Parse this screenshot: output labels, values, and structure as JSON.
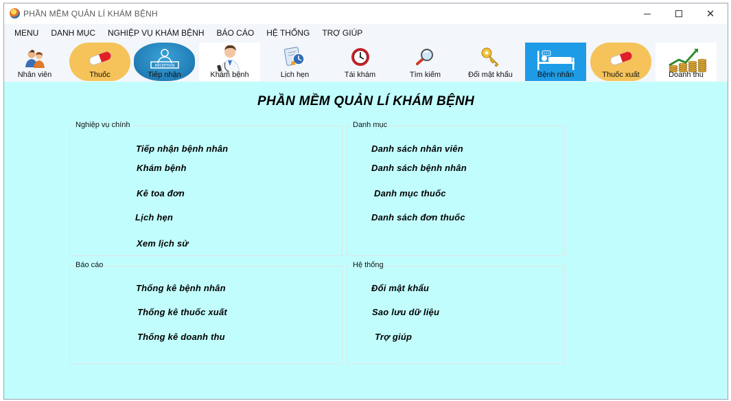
{
  "window": {
    "title": "PHẦN MỀM QUẢN LÍ KHÁM BỆNH"
  },
  "menu": [
    "MENU",
    "DANH MỤC",
    "NGHIỆP VỤ KHÁM BỆNH",
    "BÁO CÁO",
    "HỆ THỐNG",
    "TRỢ GIÚP"
  ],
  "toolbar": [
    {
      "label": "Nhân viên",
      "icon": "staff-icon"
    },
    {
      "label": "Thuốc",
      "icon": "pill-icon"
    },
    {
      "label": "Tiếp nhận",
      "icon": "reception-icon"
    },
    {
      "label": "Khám bệnh",
      "icon": "doctor-icon"
    },
    {
      "label": "Lịch hẹn",
      "icon": "calendar-clock-icon"
    },
    {
      "label": "Tái khám",
      "icon": "clock-icon"
    },
    {
      "label": "Tìm kiếm",
      "icon": "magnifier-icon"
    },
    {
      "label": "Đổi mật khẩu",
      "icon": "key-icon"
    },
    {
      "label": "Bệnh nhân",
      "icon": "patient-bed-icon"
    },
    {
      "label": "Thuốc xuất",
      "icon": "pill-icon"
    },
    {
      "label": "Doanh thu",
      "icon": "coins-chart-icon"
    }
  ],
  "main": {
    "title": "PHẦN MỀM QUẢN LÍ KHÁM BỆNH",
    "groups": {
      "nghiep_vu": {
        "legend": "Nghiệp vụ chính",
        "items": [
          "Tiếp nhận bệnh nhân",
          "Khám bệnh",
          "Kê toa đơn",
          "Lịch hẹn",
          "Xem lịch sử"
        ]
      },
      "danh_muc": {
        "legend": "Danh mục",
        "items": [
          "Danh sách nhân viên",
          "Danh sách bệnh nhân",
          "Danh mục thuốc",
          "Danh sách đơn thuốc"
        ]
      },
      "bao_cao": {
        "legend": "Báo cáo",
        "items": [
          "Thống kê bệnh nhân",
          "Thống kê thuốc xuất",
          "Thống kê doanh thu"
        ]
      },
      "he_thong": {
        "legend": "Hệ thống",
        "items": [
          "Đổi mật khẩu",
          "Sao lưu dữ liệu",
          "Trợ giúp"
        ]
      }
    }
  },
  "colors": {
    "content_bg": "#c2fdfd",
    "selected_tool_bg": "#1e9be6",
    "pill_bg": "#f5c35a"
  }
}
